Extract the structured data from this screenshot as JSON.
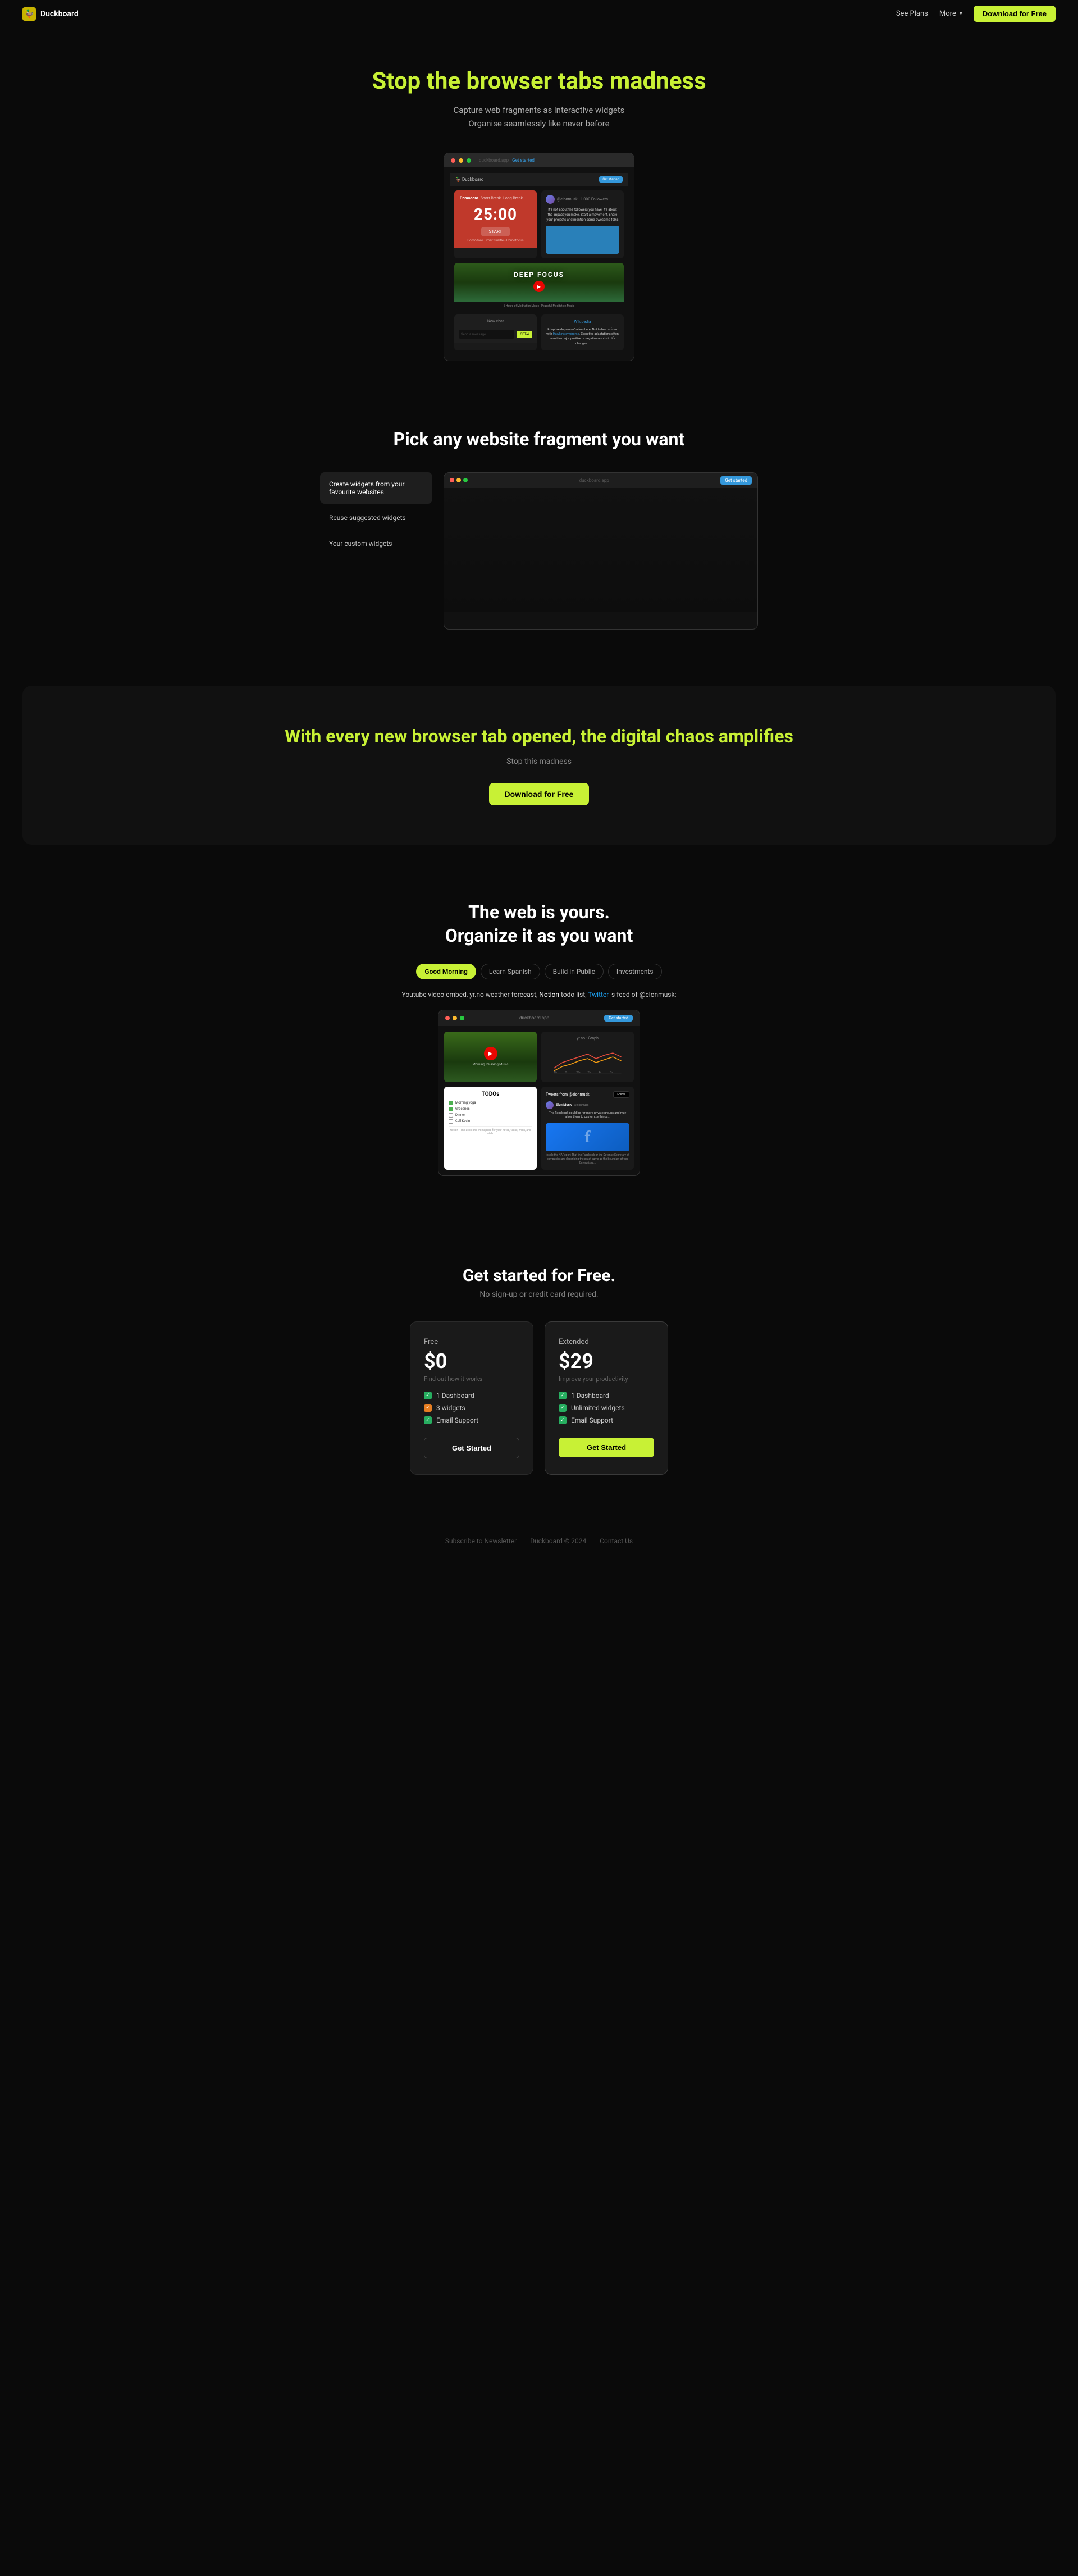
{
  "nav": {
    "logo_text": "Duckboard",
    "logo_emoji": "🦆",
    "see_plans_label": "See Plans",
    "more_label": "More",
    "download_cta": "Download for Free"
  },
  "hero": {
    "title_prefix": "Stop the ",
    "title_highlight": "browser tabs madness",
    "subtitle_line1": "Capture web fragments as interactive widgets",
    "subtitle_line2": "Organise seamlessly like never before"
  },
  "hero_dashboard": {
    "pomodoro": {
      "tabs": [
        "Pomodoro",
        "Short Break",
        "Long Break"
      ],
      "time": "25:00",
      "start_label": "START",
      "footer_label": "Pomodoro Timer: Subtle - Pomofocus"
    },
    "twitter_preview": {
      "handle": "@elonmusk",
      "text": "It's not about the followers you have, it's about the impact you make. Start a movement, not a following...",
      "followers": "1,000 Followers"
    },
    "video": {
      "title": "DEEP FOCUS",
      "subtitle": "6 Hours of Meditation Music - Peaceful Meditation Music"
    },
    "ai_text": {
      "title": "\"Adaptive dopamine\" systems here. Not to be confused with Hawkins syndrome",
      "body": "\"Adaptive dopamine\" refers to here. Not to be confused with Hawkins syndrome...",
      "context_label": "Positive adaptations often result in cognitive major positive or negative results in life changes..."
    },
    "chat": {
      "header": "New chat",
      "placeholder": "Send a message...",
      "send_label": "GPT-4"
    }
  },
  "pick_section": {
    "heading": "Pick any website fragment you want",
    "sidebar_items": [
      {
        "label": "Create widgets from your favourite websites",
        "active": true
      },
      {
        "label": "Reuse suggested widgets"
      },
      {
        "label": "Your custom widgets"
      }
    ]
  },
  "chaos_section": {
    "heading_prefix": "With every new browser ",
    "heading_highlight": "tab opened",
    "heading_suffix": ", the digital chaos amplifies",
    "sub": "Stop this madness",
    "cta": "Download for Free"
  },
  "organize_section": {
    "heading_line1": "The web is yours.",
    "heading_line2": "Organize it as you want",
    "tabs": [
      {
        "label": "Good Morning",
        "active": true
      },
      {
        "label": "Learn Spanish"
      },
      {
        "label": "Build in Public"
      },
      {
        "label": "Investments"
      }
    ],
    "description": "Youtube video embed, yr.no weather forecast, Notion todo list, Twitter's feed of @elonmusk:",
    "todo_items": [
      {
        "label": "Morning yoga",
        "checked": true
      },
      {
        "label": "Groceries",
        "checked": true
      },
      {
        "label": "Dinner",
        "checked": false
      },
      {
        "label": "Call Kevin",
        "checked": false
      }
    ],
    "todo_title": "TODOs",
    "todo_footer": "Notion - The all-in-one workspace for your notes, tasks, wikis, and datab...",
    "tweets_title": "Tweets from @elonmusk",
    "tweet_user": "Elon Musk",
    "tweet_handle": "@elonmusk",
    "tweet_text": "The Facebook could be far more private groups and may allow them to customize things...",
    "tweet_caption": "Inside the NAReport That the Facebook or the Defense Secretary of companies are describing the exact same as the boundary of free Enterprises..."
  },
  "pricing_section": {
    "heading": "Get started for Free.",
    "sub": "No sign-up or credit card required.",
    "free": {
      "name": "Free",
      "price": "$0",
      "desc": "Find out how it works",
      "features": [
        {
          "label": "1 Dashboard",
          "check": "green"
        },
        {
          "label": "3 widgets",
          "check": "orange"
        },
        {
          "label": "Email Support",
          "check": "green"
        }
      ],
      "cta": "Get Started"
    },
    "extended": {
      "name": "Extended",
      "price": "$29",
      "desc": "Improve your productivity",
      "features": [
        {
          "label": "1 Dashboard",
          "check": "green"
        },
        {
          "label": "Unlimited widgets",
          "check": "green"
        },
        {
          "label": "Email Support",
          "check": "green"
        }
      ],
      "cta": "Get Started"
    }
  },
  "footer": {
    "links": [
      {
        "label": "Subscribe to Newsletter"
      },
      {
        "label": "Duckboard © 2024"
      },
      {
        "label": "Contact Us"
      }
    ]
  }
}
